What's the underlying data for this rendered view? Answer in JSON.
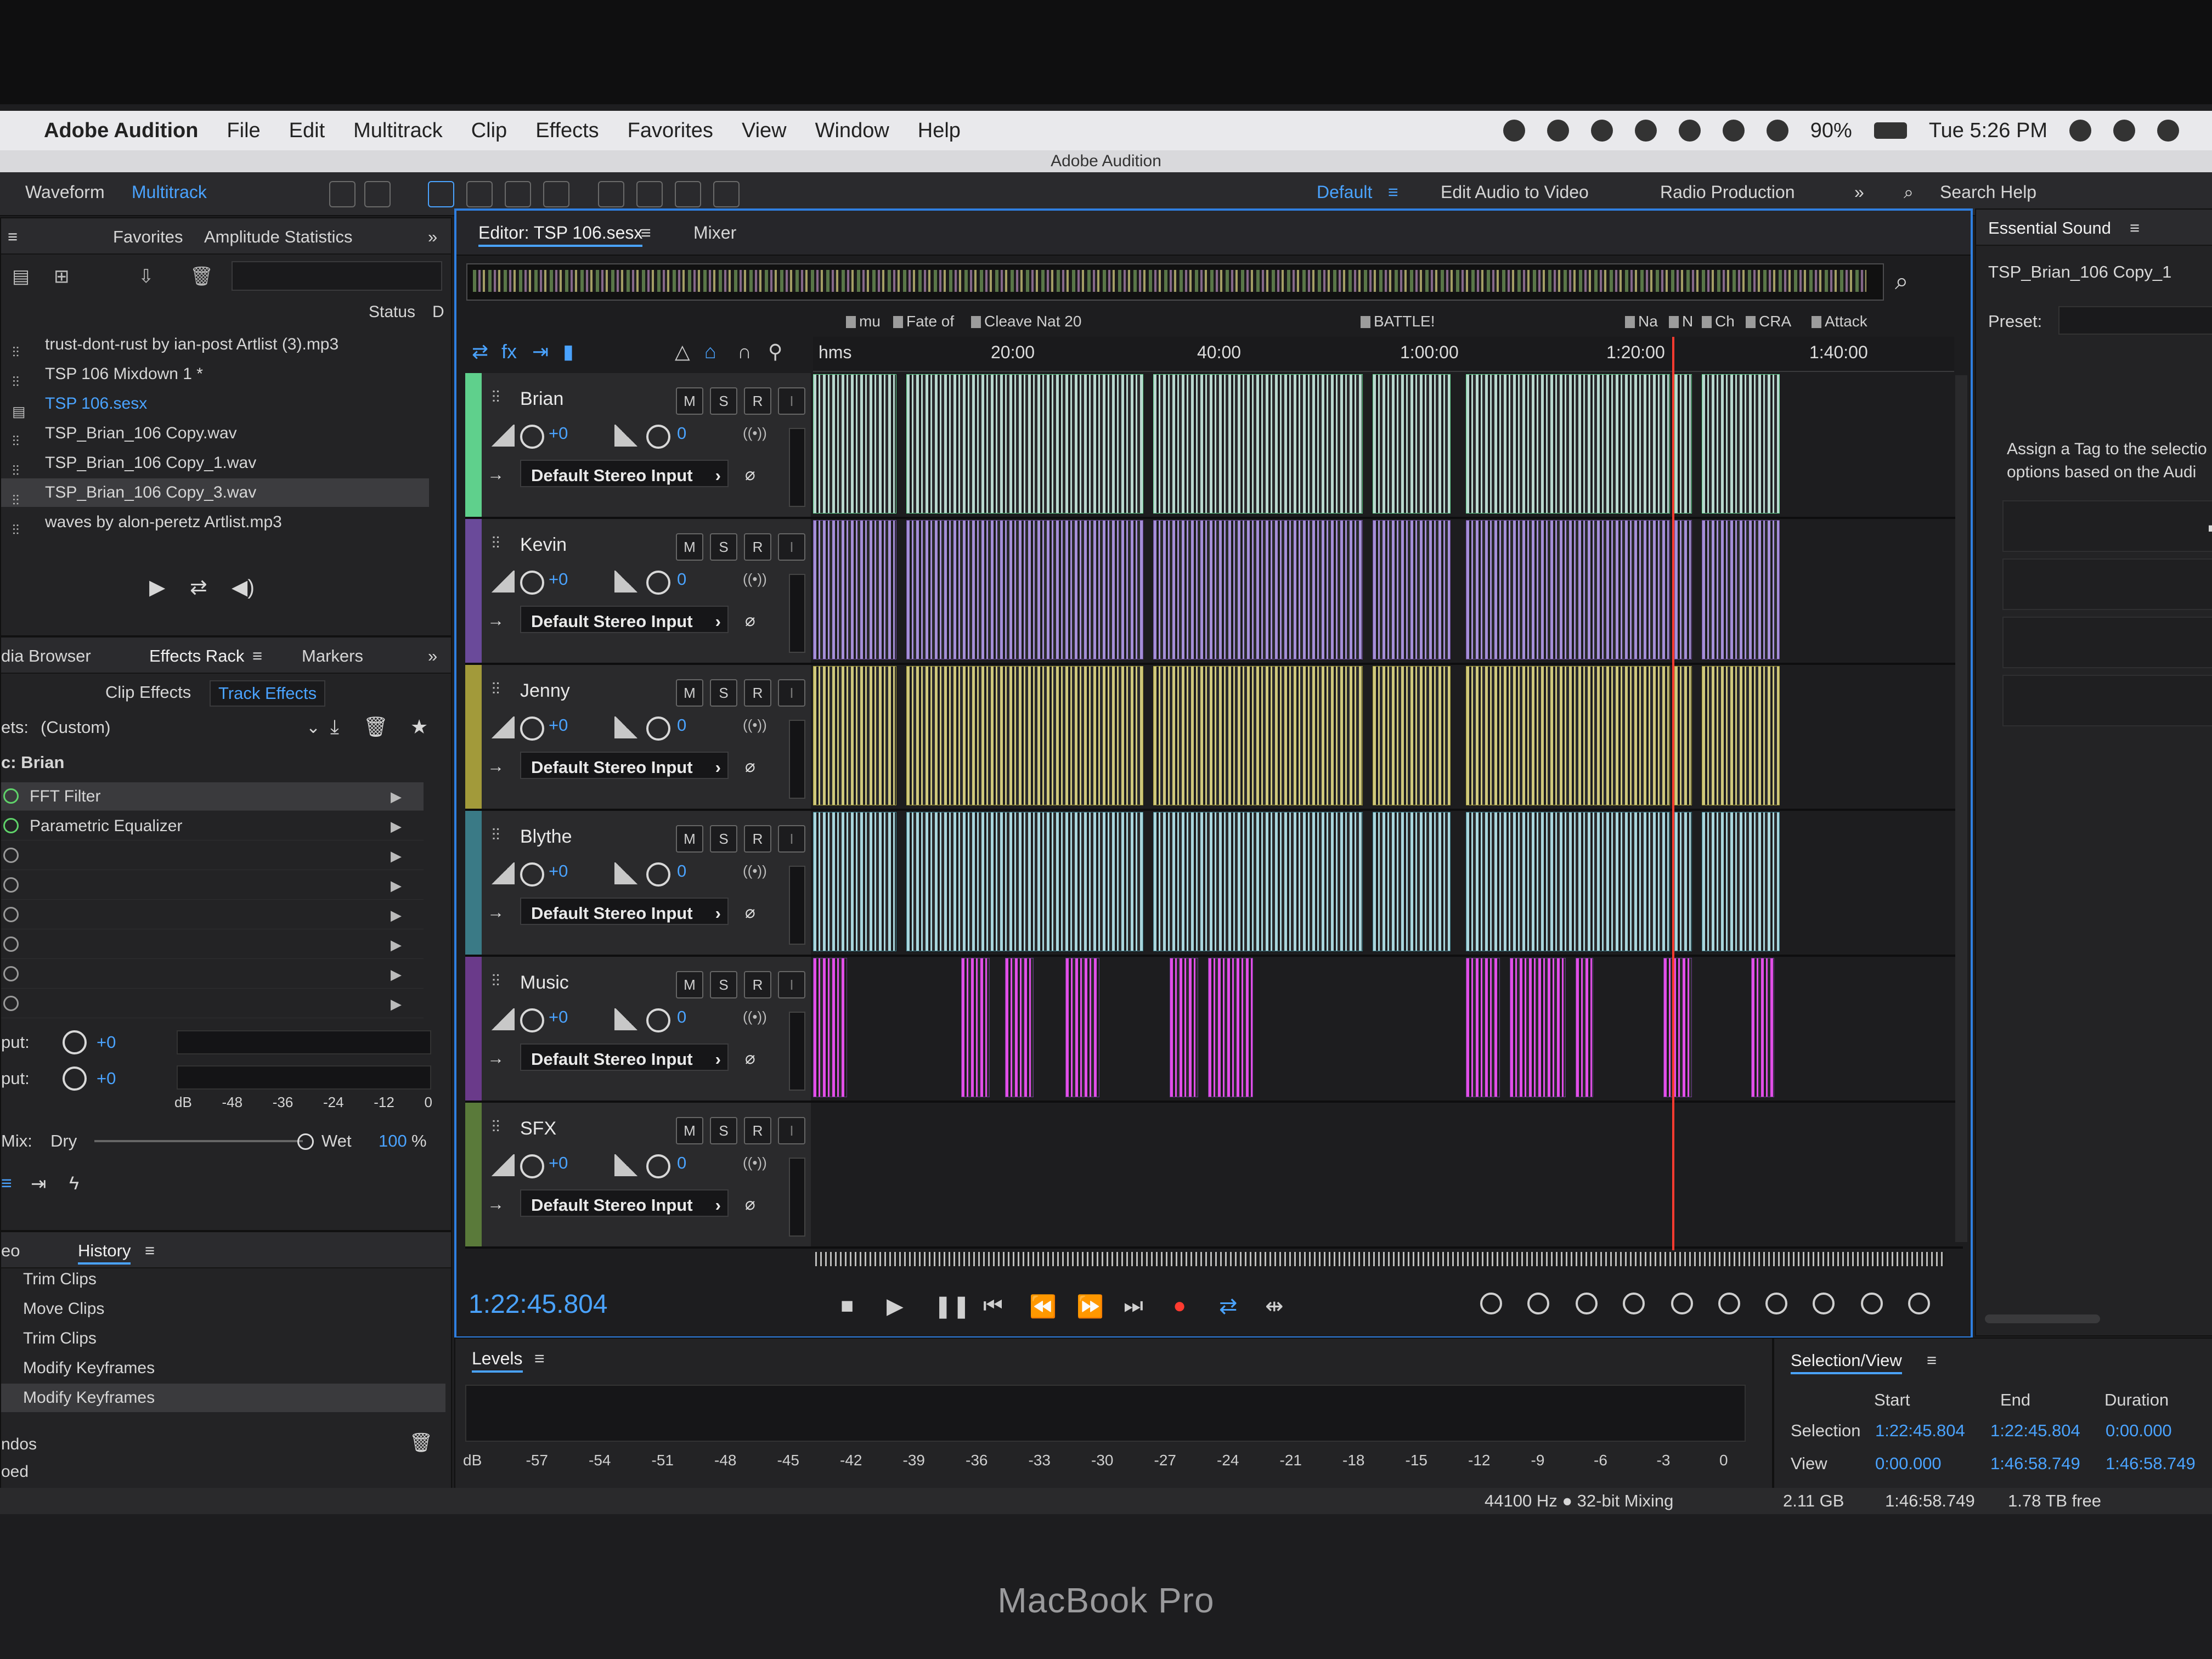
{
  "device": {
    "label": "MacBook Pro"
  },
  "menubar": {
    "app": "Adobe Audition",
    "items": [
      "File",
      "Edit",
      "Multitrack",
      "Clip",
      "Effects",
      "Favorites",
      "View",
      "Window",
      "Help"
    ],
    "battery": "90%",
    "clock": "Tue 5:26 PM"
  },
  "window": {
    "title": "Adobe Audition"
  },
  "toolbar": {
    "waveform": "Waveform",
    "multitrack": "Multitrack",
    "workspaces": [
      "Default",
      "Edit Audio to Video",
      "Radio Production"
    ],
    "search": "Search Help"
  },
  "files_panel": {
    "tabs": [
      "Favorites",
      "Amplitude Statistics"
    ],
    "col_status": "Status",
    "col_d": "D",
    "files": [
      "trust-dont-rust by ian-post Artlist (3).mp3",
      "TSP 106 Mixdown 1 *",
      "TSP 106.sesx",
      "TSP_Brian_106 Copy.wav",
      "TSP_Brian_106 Copy_1.wav",
      "TSP_Brian_106 Copy_3.wav",
      "waves by alon-peretz Artlist.mp3"
    ]
  },
  "effects_panel": {
    "tabs": [
      "dia Browser",
      "Effects Rack",
      "Markers"
    ],
    "subtabs": [
      "Clip Effects",
      "Track Effects"
    ],
    "presets_label": "ets:",
    "preset_value": "(Custom)",
    "track_label": "c: Brian",
    "effects": [
      "FFT Filter",
      "Parametric Equalizer"
    ],
    "input_label": "put:",
    "output_label": "put:",
    "io_value_1": "+0",
    "io_value_2": "+0",
    "meter_scale": [
      "dB",
      "-48",
      "-36",
      "-24",
      "-12",
      "0"
    ],
    "mix_label": "Mix:",
    "dry": "Dry",
    "wet": "Wet",
    "wet_value": "100",
    "wet_unit": "%"
  },
  "history_panel": {
    "tab": "History",
    "left_tab": "eo",
    "items": [
      "Trim Clips",
      "Move Clips",
      "Trim Clips",
      "Modify Keyframes",
      "Modify Keyframes"
    ],
    "undos": "ndos",
    "opened": "oed"
  },
  "editor": {
    "tab": "Editor: TSP 106.sesx",
    "mixer_tab": "Mixer",
    "ruler_unit": "hms",
    "ruler_ticks": [
      "20:00",
      "40:00",
      "1:00:00",
      "1:20:00",
      "1:40:00"
    ],
    "markers": [
      "mu",
      "Fate of",
      "Cleave Nat 20",
      "BATTLE!",
      "Na",
      "N",
      "Ch",
      "CRA",
      "Attack"
    ],
    "tracks": [
      {
        "name": "Brian",
        "vol": "+0",
        "pan": "0",
        "input": "Default Stereo Input",
        "color": "#5fd08c",
        "clip": "#b9d8cf"
      },
      {
        "name": "Kevin",
        "vol": "+0",
        "pan": "0",
        "input": "Default Stereo Input",
        "color": "#6a4a9a",
        "clip": "#a58fd8"
      },
      {
        "name": "Jenny",
        "vol": "+0",
        "pan": "0",
        "input": "Default Stereo Input",
        "color": "#a29a3a",
        "clip": "#cfc87c"
      },
      {
        "name": "Blythe",
        "vol": "+0",
        "pan": "0",
        "input": "Default Stereo Input",
        "color": "#3a7a86",
        "clip": "#a9d6dd"
      },
      {
        "name": "Music",
        "vol": "+0",
        "pan": "0",
        "input": "Default Stereo Input",
        "color": "#6a3a8a",
        "clip": "#e24ee8"
      },
      {
        "name": "SFX",
        "vol": "+0",
        "pan": "0",
        "input": "Default Stereo Input",
        "color": "#5a7a3a",
        "clip": "#222"
      }
    ],
    "timecode": "1:22:45.804"
  },
  "essential_sound": {
    "title": "Essential Sound",
    "clip": "TSP_Brian_106 Copy_1",
    "preset_label": "Preset:",
    "assign_text_1": "Assign a Tag to the selectio",
    "assign_text_2": "options based on the Audi"
  },
  "levels": {
    "title": "Levels",
    "scale": [
      "dB",
      "-57",
      "-54",
      "-51",
      "-48",
      "-45",
      "-42",
      "-39",
      "-36",
      "-33",
      "-30",
      "-27",
      "-24",
      "-21",
      "-18",
      "-15",
      "-12",
      "-9",
      "-6",
      "-3",
      "0"
    ]
  },
  "selection_view": {
    "title": "Selection/View",
    "headers": [
      "Start",
      "End",
      "Duration"
    ],
    "selection_label": "Selection",
    "view_label": "View",
    "selection": [
      "1:22:45.804",
      "1:22:45.804",
      "0:00.000"
    ],
    "view": [
      "0:00.000",
      "1:46:58.749",
      "1:46:58.749"
    ]
  },
  "status": {
    "format": "44100 Hz ● 32-bit Mixing",
    "memory": "2.11 GB",
    "duration": "1:46:58.749",
    "free": "1.78 TB free"
  }
}
